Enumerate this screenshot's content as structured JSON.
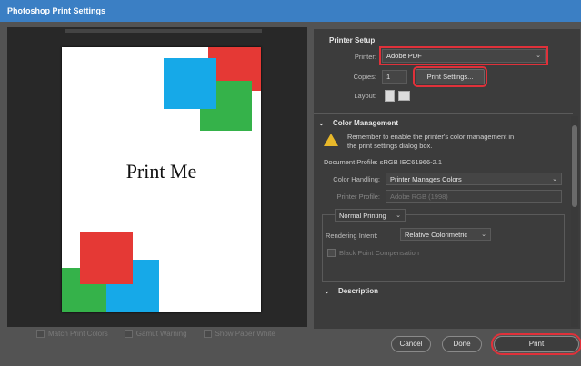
{
  "window": {
    "title": "Photoshop Print Settings"
  },
  "preview": {
    "page_text": "Print Me",
    "colors": {
      "red": "#e53935",
      "blue": "#16a9e8",
      "green": "#35b24a"
    }
  },
  "bottom_options": [
    {
      "label": "Match Print Colors"
    },
    {
      "label": "Gamut Warning"
    },
    {
      "label": "Show Paper White"
    }
  ],
  "printer_setup": {
    "heading": "Printer Setup",
    "printer_label": "Printer:",
    "printer_value": "Adobe PDF",
    "copies_label": "Copies:",
    "copies_value": "1",
    "print_settings_button": "Print Settings...",
    "layout_label": "Layout:"
  },
  "color_management": {
    "heading": "Color Management",
    "warning": "Remember to enable the printer's color management in the print settings dialog box.",
    "document_profile": "Document Profile: sRGB IEC61966-2.1",
    "color_handling_label": "Color Handling:",
    "color_handling_value": "Printer Manages Colors",
    "printer_profile_label": "Printer Profile:",
    "printer_profile_value": "Adobe RGB (1998)",
    "mode_value": "Normal Printing",
    "rendering_intent_label": "Rendering Intent:",
    "rendering_intent_value": "Relative Colorimetric",
    "black_point_label": "Black Point Compensation"
  },
  "description": {
    "heading": "Description"
  },
  "footer": {
    "cancel": "Cancel",
    "done": "Done",
    "print": "Print"
  }
}
